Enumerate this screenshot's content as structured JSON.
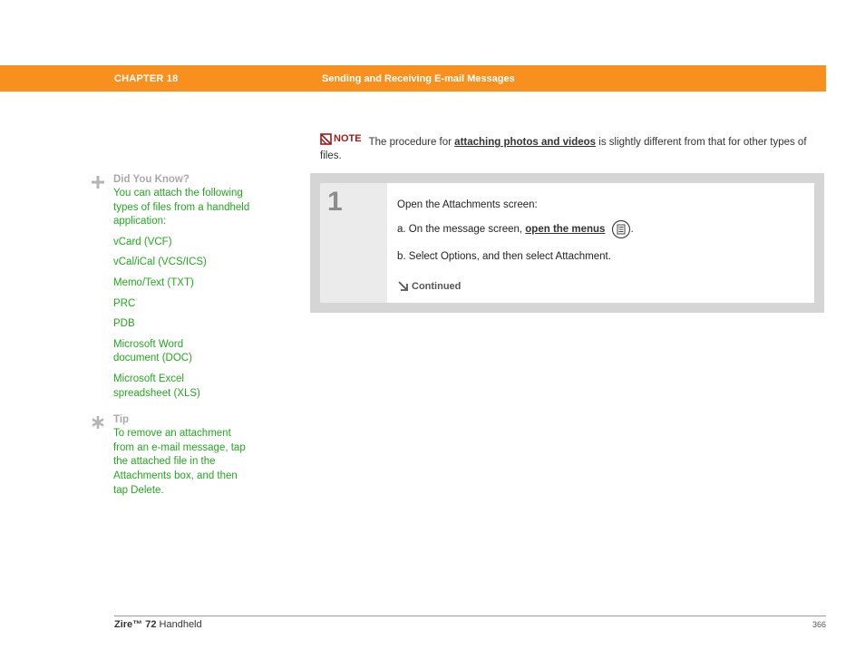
{
  "colors": {
    "accent": "#f7901e",
    "green": "#22a81e",
    "note_red": "#9b1b1b"
  },
  "header": {
    "chapter": "CHAPTER 18",
    "title": "Sending and Receiving E-mail Messages"
  },
  "note": {
    "label": "NOTE",
    "text_before": "The procedure for ",
    "link": "attaching photos and videos",
    "text_after": " is slightly different from that for other types of files."
  },
  "sidebar": {
    "did_you_know": {
      "heading": "Did You Know?",
      "intro": "You can attach the following types of files from a handheld application:",
      "items": [
        "vCard (VCF)",
        "vCal/iCal (VCS/ICS)",
        "Memo/Text (TXT)",
        "PRC",
        "PDB",
        "Microsoft Word document (DOC)",
        "Microsoft Excel spreadsheet (XLS)"
      ]
    },
    "tip": {
      "heading": "Tip",
      "text": "To remove an attachment from an e-mail message, tap the attached file in the Attachments box, and then tap Delete."
    }
  },
  "step": {
    "number": "1",
    "intro": "Open the Attachments screen:",
    "a_prefix": "a.  On the message screen, ",
    "a_link": "open the menus",
    "a_suffix": ".",
    "b": "b.  Select Options, and then select Attachment.",
    "continued": "Continued"
  },
  "footer": {
    "product": "Zire™ 72",
    "product_suffix": " Handheld",
    "page": "366"
  }
}
